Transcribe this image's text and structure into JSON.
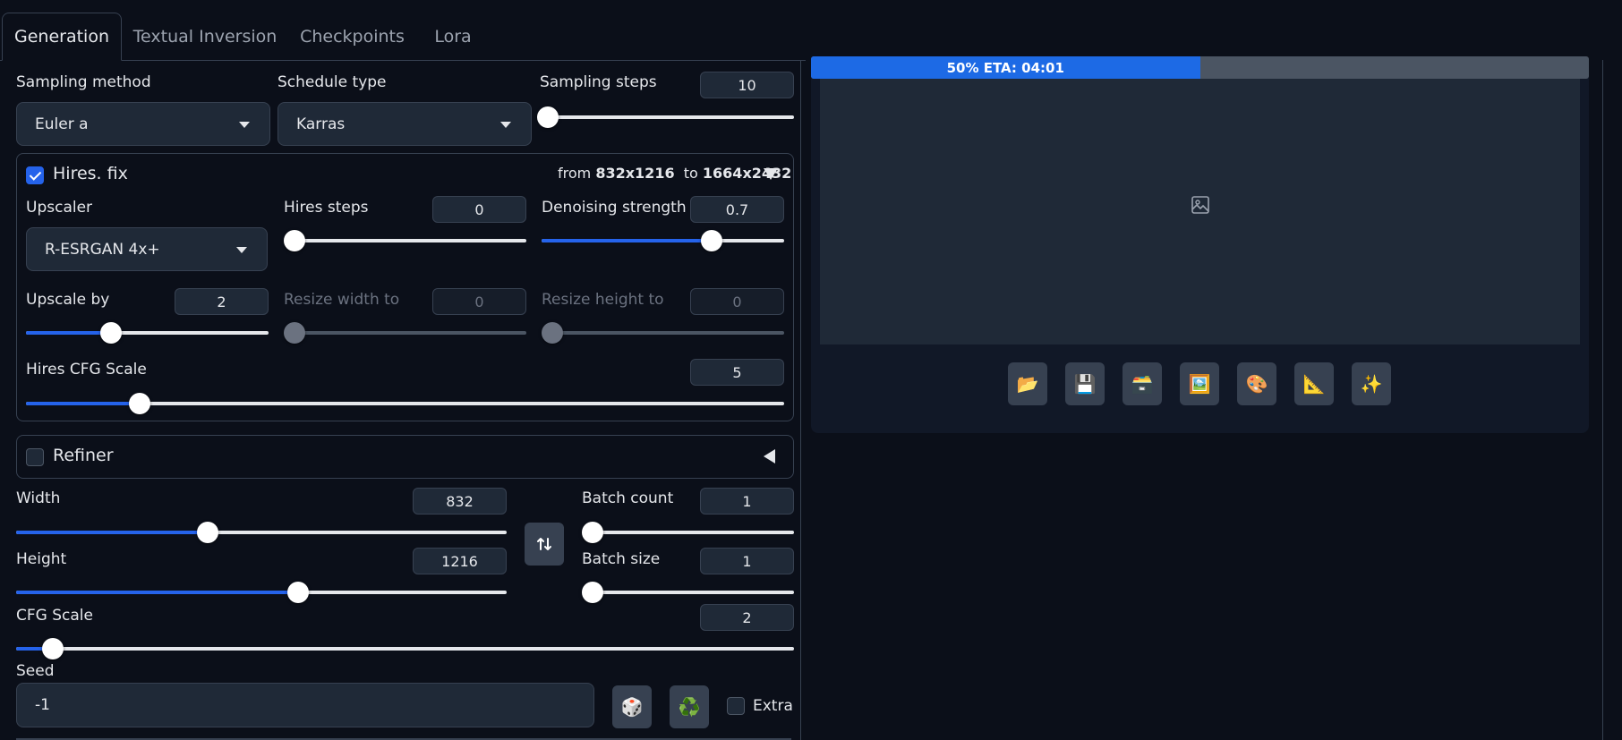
{
  "tabs": [
    {
      "label": "Generation"
    },
    {
      "label": "Textual Inversion"
    },
    {
      "label": "Checkpoints"
    },
    {
      "label": "Lora"
    }
  ],
  "sampling": {
    "method_label": "Sampling method",
    "method_value": "Euler a",
    "schedule_label": "Schedule type",
    "schedule_value": "Karras",
    "steps_label": "Sampling steps",
    "steps_value": "10"
  },
  "hires": {
    "title": "Hires. fix",
    "checked": true,
    "from_word": "from",
    "from_size": "832x1216",
    "to_word": "to",
    "to_size": "1664x2432",
    "upscaler_label": "Upscaler",
    "upscaler_value": "R-ESRGAN 4x+",
    "steps_label": "Hires steps",
    "steps_value": "0",
    "denoise_label": "Denoising strength",
    "denoise_value": "0.7",
    "upscale_by_label": "Upscale by",
    "upscale_by_value": "2",
    "resize_w_label": "Resize width to",
    "resize_w_value": "0",
    "resize_h_label": "Resize height to",
    "resize_h_value": "0",
    "cfg_label": "Hires CFG Scale",
    "cfg_value": "5"
  },
  "refiner": {
    "title": "Refiner",
    "checked": false
  },
  "dims": {
    "width_label": "Width",
    "width_value": "832",
    "height_label": "Height",
    "height_value": "1216",
    "batch_count_label": "Batch count",
    "batch_count_value": "1",
    "batch_size_label": "Batch size",
    "batch_size_value": "1",
    "cfg_label": "CFG Scale",
    "cfg_value": "2"
  },
  "seed": {
    "label": "Seed",
    "value": "-1",
    "extra_label": "Extra"
  },
  "progress": {
    "text": "50% ETA: 04:01",
    "fraction": 0.5
  },
  "slider_levels": {
    "sampling_steps": 0.03,
    "hires_steps": 0.0,
    "denoise": 0.7,
    "upscale_by": 0.35,
    "resize_w": 0.0,
    "resize_h": 0.0,
    "hires_cfg": 0.15,
    "width": 0.39,
    "height": 0.575,
    "batch_count": 0.0,
    "batch_size": 0.0,
    "cfg": 0.047
  },
  "gallery_tools": [
    {
      "icon": "📂",
      "name": "open-folder"
    },
    {
      "icon": "💾",
      "name": "save"
    },
    {
      "icon": "🗃️",
      "name": "zip"
    },
    {
      "icon": "🖼️",
      "name": "send-to-img2img"
    },
    {
      "icon": "🎨",
      "name": "send-to-inpaint"
    },
    {
      "icon": "📐",
      "name": "send-to-extras"
    },
    {
      "icon": "✨",
      "name": "upscale"
    }
  ],
  "colors": {
    "accent": "#2563eb",
    "background": "#0b0f19",
    "panel": "#1f2937"
  }
}
